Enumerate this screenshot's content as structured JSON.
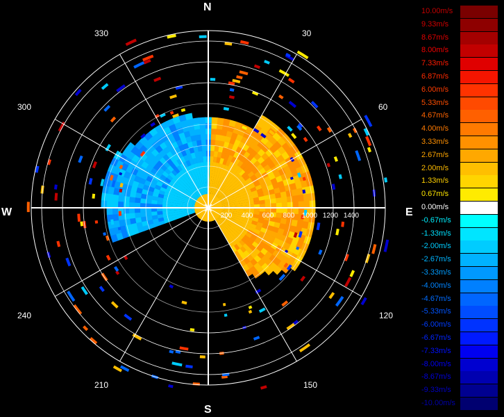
{
  "compass": {
    "north": "N",
    "east": "E",
    "south": "S",
    "west": "W"
  },
  "azimuth_labels": [
    "30",
    "60",
    "120",
    "150",
    "210",
    "240",
    "300",
    "330"
  ],
  "range_labels": [
    "200",
    "400",
    "600",
    "800",
    "1000",
    "1200",
    "1400"
  ],
  "legend": [
    {
      "label": "10.00m/s",
      "color": "#7a0000",
      "text_color": "#c00000"
    },
    {
      "label": "9.33m/s",
      "color": "#8e0000",
      "text_color": "#d00000"
    },
    {
      "label": "8.67m/s",
      "color": "#a40000",
      "text_color": "#e00000"
    },
    {
      "label": "8.00m/s",
      "color": "#c20000",
      "text_color": "#f00000"
    },
    {
      "label": "7.33m/s",
      "color": "#e00000",
      "text_color": "#ff1a00"
    },
    {
      "label": "6.87m/s",
      "color": "#f51500",
      "text_color": "#ff2a00"
    },
    {
      "label": "6.00m/s",
      "color": "#ff3300",
      "text_color": "#ff3c00"
    },
    {
      "label": "5.33m/s",
      "color": "#ff4a00",
      "text_color": "#ff4e00"
    },
    {
      "label": "4.67m/s",
      "color": "#ff6000",
      "text_color": "#ff6400"
    },
    {
      "label": "4.00m/s",
      "color": "#ff7a00",
      "text_color": "#ff7a00"
    },
    {
      "label": "3.33m/s",
      "color": "#ff9100",
      "text_color": "#ff9000"
    },
    {
      "label": "2.67m/s",
      "color": "#ffa800",
      "text_color": "#ffa600"
    },
    {
      "label": "2.00m/s",
      "color": "#ffbf00",
      "text_color": "#ffbc00"
    },
    {
      "label": "1.33m/s",
      "color": "#ffd500",
      "text_color": "#ffd000"
    },
    {
      "label": "0.67m/s",
      "color": "#ffeb00",
      "text_color": "#ffe600"
    },
    {
      "label": "0.00m/s",
      "color": "#ffffff",
      "text_color": "#ffffff"
    },
    {
      "label": "-0.67m/s",
      "color": "#00ffff",
      "text_color": "#00f0ff"
    },
    {
      "label": "-1.33m/s",
      "color": "#00e5ff",
      "text_color": "#00e0ff"
    },
    {
      "label": "-2.00m/s",
      "color": "#00ccff",
      "text_color": "#00ccff"
    },
    {
      "label": "-2.67m/s",
      "color": "#00b2ff",
      "text_color": "#00b4ff"
    },
    {
      "label": "-3.33m/s",
      "color": "#0099ff",
      "text_color": "#009cff"
    },
    {
      "label": "-4.00m/s",
      "color": "#0080ff",
      "text_color": "#0084ff"
    },
    {
      "label": "-4.67m/s",
      "color": "#0066ff",
      "text_color": "#006cff"
    },
    {
      "label": "-5.33m/s",
      "color": "#004dff",
      "text_color": "#0054ff"
    },
    {
      "label": "-6.00m/s",
      "color": "#0033ff",
      "text_color": "#003cff"
    },
    {
      "label": "-6.67m/s",
      "color": "#001aff",
      "text_color": "#0024ff"
    },
    {
      "label": "-7.33m/s",
      "color": "#0000f0",
      "text_color": "#0010ff"
    },
    {
      "label": "-8.00m/s",
      "color": "#0000d0",
      "text_color": "#0000f0"
    },
    {
      "label": "-8.67m/s",
      "color": "#0000b0",
      "text_color": "#0000d8"
    },
    {
      "label": "-9.33m/s",
      "color": "#000090",
      "text_color": "#0000c0"
    },
    {
      "label": "-10.00m/s",
      "color": "#000070",
      "text_color": "#0000a8"
    }
  ]
}
